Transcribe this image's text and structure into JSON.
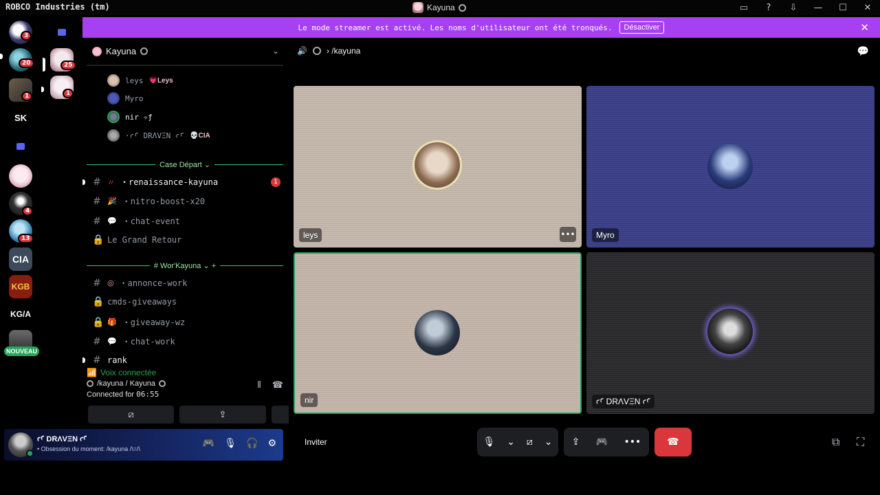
{
  "titlebar": {
    "app_name": "ROBCO Industries (tm)",
    "window_title": "Kayuna",
    "icons": [
      "inbox-icon",
      "help-icon",
      "download-icon",
      "minimize-icon",
      "maximize-icon",
      "close-icon"
    ],
    "glyphs": [
      "▭",
      "?",
      "⇩",
      "—",
      "☐",
      "✕"
    ]
  },
  "rail": {
    "badges": [
      "3",
      "20",
      "25",
      "1",
      "1",
      "4",
      "13"
    ],
    "labels": [
      "SK",
      "CIA",
      "KGB",
      "KG/A"
    ],
    "new_label": "NOUVEAU"
  },
  "banner": {
    "text": "Le mode streamer est activé. Les noms d'utilisateur ont été tronqués.",
    "button": "Désactiver",
    "close": "✕",
    "color": "#a640f0"
  },
  "guild": {
    "name": "Kayuna",
    "chevron": "⌄"
  },
  "voice_users": [
    {
      "name": "leys",
      "tag": "💗Leys"
    },
    {
      "name": "Myro",
      "tag": ""
    },
    {
      "name": "nir ✧ƒ",
      "tag": ""
    },
    {
      "name": "·⁠ꜥꜤ DRΛVΞN ꜥꜤ",
      "tag": "💀CIA"
    }
  ],
  "categories": {
    "cat1": "Case Départ ⌄",
    "cat2": "# Wor'Kayuna ⌄ +"
  },
  "channels": [
    {
      "name": "・renaissance-kayuna",
      "emoji": "〃",
      "badge": "1"
    },
    {
      "name": "・nitro-boost-x20",
      "emoji": "🎉"
    },
    {
      "name": "・chat-event",
      "emoji": "💬"
    },
    {
      "name": "Le Grand Retour",
      "emoji": ""
    },
    {
      "name": "・annonce-work",
      "emoji": "◎"
    },
    {
      "name": "cmds-giveaways",
      "emoji": ""
    },
    {
      "name": "・giveaway-wz",
      "emoji": "🎁"
    },
    {
      "name": "・chat-work",
      "emoji": "💬"
    },
    {
      "name": "rank",
      "emoji": ""
    }
  ],
  "voice_panel": {
    "status": "Voix connectée",
    "channel": "/kayuna / Kayuna",
    "connected_prefix": "Connected for",
    "connected_time": "06:55"
  },
  "user": {
    "name": "ꜥꜤ DRΛVΞN ꜥꜤ",
    "status": "• Obsession du moment: /kayuna /\\=/\\"
  },
  "stage": {
    "breadcrumb": "/kayuna",
    "tiles": [
      {
        "label": "leys",
        "bg": "#c8bcb0"
      },
      {
        "label": "Myro",
        "bg": "#3a3f8a"
      },
      {
        "label": "nir",
        "bg": "#c8b8ae",
        "speaking_color": "#23a55a"
      },
      {
        "label": "ꜥꜤ DRΛVΞN ꜥꜤ",
        "bg": "#2a2a2c"
      }
    ],
    "invite": "Inviter"
  },
  "controls": {
    "mic": "🎙",
    "caret": "⌄",
    "camera_off": "⧄",
    "screenshare": "⇪",
    "activity": "🎮",
    "more": "•••",
    "hangup": "☎",
    "popout": "⧉",
    "fullscreen": "⛶"
  },
  "colors": {
    "accent_green": "#23a55a",
    "danger_red": "#da373c",
    "blurple": "#5865f2"
  }
}
